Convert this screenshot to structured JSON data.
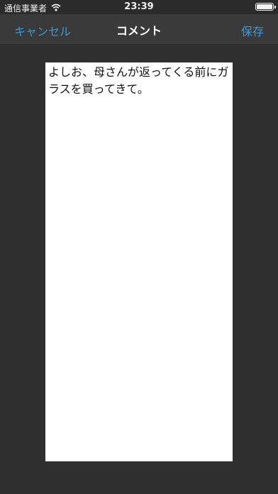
{
  "status_bar": {
    "carrier": "通信事業者",
    "time": "23:39",
    "battery_level": 1.0,
    "icons": [
      "wifi-icon",
      "battery-icon"
    ]
  },
  "nav": {
    "cancel_label": "キャンセル",
    "title": "コメント",
    "save_label": "保存"
  },
  "comment": {
    "text": "よしお、母さんが返ってくる前にガラスを買ってきて。"
  },
  "colors": {
    "accent": "#3a9ad9",
    "background": "#2f2f2f",
    "nav_background": "#3a3a3a"
  }
}
